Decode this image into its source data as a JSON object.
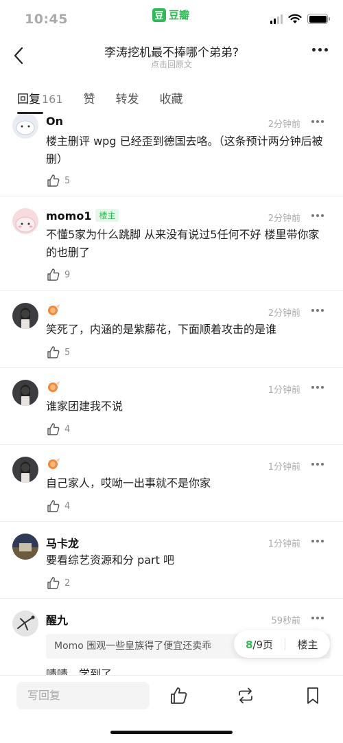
{
  "status_bar": {
    "time": "10:45",
    "app_logo_char": "豆",
    "app_name": "豆瓣"
  },
  "nav": {
    "title": "李涛挖机最不捧哪个弟弟?",
    "subtitle": "点击回原文"
  },
  "tabs": [
    {
      "label": "回复",
      "count": "161",
      "active": true
    },
    {
      "label": "赞",
      "count": ""
    },
    {
      "label": "转发",
      "count": ""
    },
    {
      "label": "收藏",
      "count": ""
    }
  ],
  "comments": [
    {
      "name": "On",
      "badge": "",
      "time": "2分钟前",
      "text": "楼主删评 wpg 已经歪到德国去咯。（这条预计两分钟后被删）",
      "likes": "5"
    },
    {
      "name": "momo1",
      "badge": "楼主",
      "time": "2分钟前",
      "text": "不懂5家为什么跳脚 从来没有说过5任何不好 楼里带你家的也删了",
      "likes": "9"
    },
    {
      "name": "",
      "badge": "",
      "time": "2分钟前",
      "text": "笑死了，内涵的是紫藤花，下面顺着攻击的是谁",
      "likes": "5"
    },
    {
      "name": "",
      "badge": "",
      "time": "1分钟前",
      "text": "谁家团建我不说",
      "likes": "4"
    },
    {
      "name": "",
      "badge": "",
      "time": "1分钟前",
      "text": "自己家人，哎呦一出事就不是你家",
      "likes": "4"
    },
    {
      "name": "马卡龙",
      "badge": "",
      "time": "1分钟前",
      "text": "要看综艺资源和分 part 吧",
      "likes": "2"
    },
    {
      "name": "醒九",
      "badge": "",
      "time": "59秒前",
      "quote": "Momo 围观一些皇族得了便宜还卖乖",
      "text": "啧啧，学到了",
      "likes": ""
    }
  ],
  "pager": {
    "current": "8",
    "total": "/9页",
    "op_label": "楼主"
  },
  "bottom_bar": {
    "reply_placeholder": "写回复"
  },
  "colors": {
    "accent": "#2dbb55",
    "text": "#222222",
    "muted": "#aaaaaa"
  }
}
